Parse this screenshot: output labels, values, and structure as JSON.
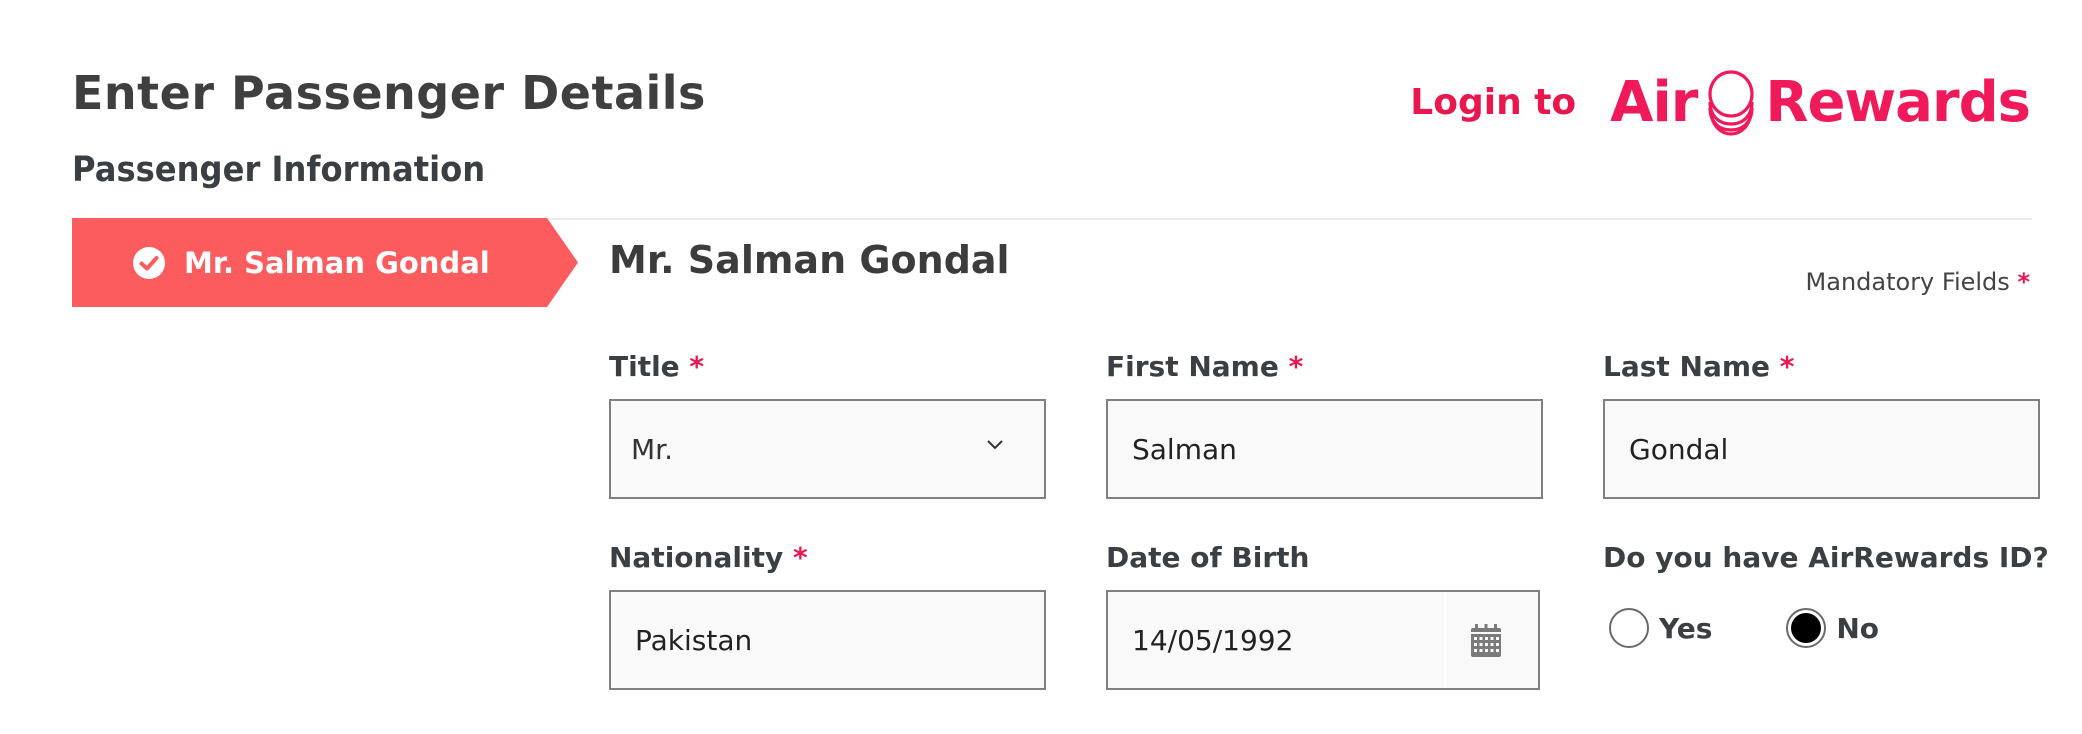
{
  "header": {
    "page_title": "Enter Passenger Details",
    "section_title": "Passenger Information",
    "login_label": "Login to",
    "brand": {
      "word1": "Air",
      "word2": "Rewards",
      "color": "#f0195a"
    }
  },
  "passenger_tab": {
    "label": "Mr. Salman Gondal",
    "status_icon": "check-circle-icon",
    "color": "#fd5c5f"
  },
  "form": {
    "heading": "Mr. Salman Gondal",
    "mandatory_note": "Mandatory Fields",
    "required_mark": "*",
    "fields": {
      "title": {
        "label": "Title",
        "required": true,
        "value": "Mr.",
        "type": "select"
      },
      "first_name": {
        "label": "First Name",
        "required": true,
        "value": "Salman"
      },
      "last_name": {
        "label": "Last Name",
        "required": true,
        "value": "Gondal"
      },
      "nationality": {
        "label": "Nationality",
        "required": true,
        "value": "Pakistan"
      },
      "dob": {
        "label": "Date of Birth",
        "required": false,
        "value": "14/05/1992",
        "icon": "calendar-icon"
      }
    },
    "airrewards_question": {
      "label": "Do you have AirRewards ID?",
      "options": [
        {
          "label": "Yes",
          "selected": false
        },
        {
          "label": "No",
          "selected": true
        }
      ]
    }
  },
  "colors": {
    "accent_red": "#e8184f",
    "tab_red": "#fd5c5f",
    "border": "#808080",
    "field_bg": "#f9f9f9"
  }
}
